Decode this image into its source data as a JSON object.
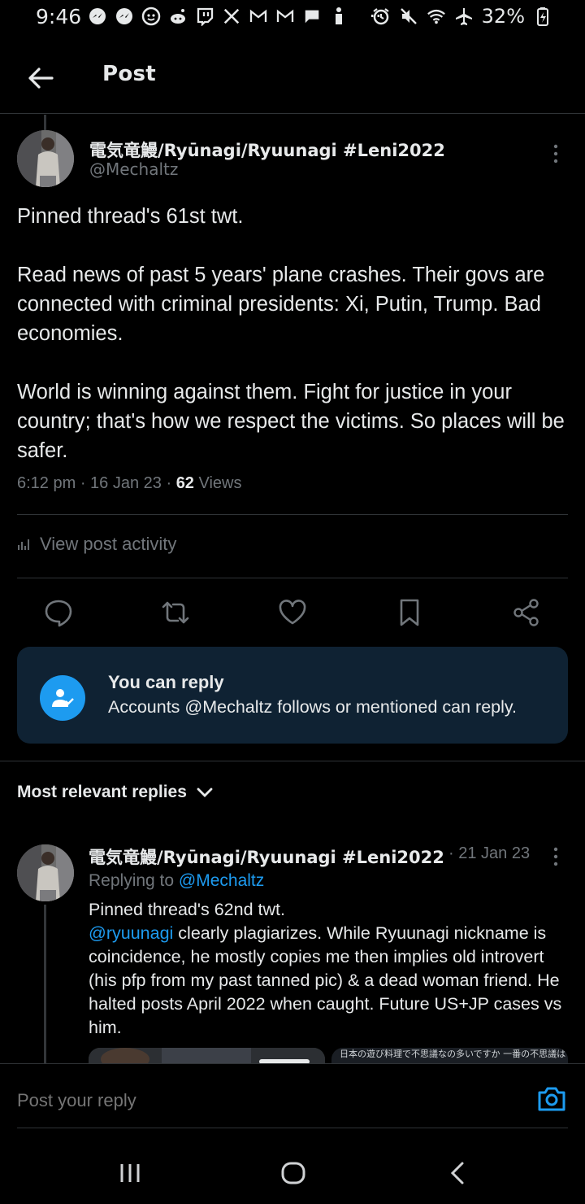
{
  "status_bar": {
    "time": "9:46",
    "battery": "32%",
    "dots": "··"
  },
  "header": {
    "title": "Post"
  },
  "post": {
    "author_name": "電気竜鰻/Ryūnagi/Ryuunagi #Leni2022",
    "handle": "@Mechaltz",
    "paragraphs": [
      "Pinned thread's 61st twt.",
      "Read news of past 5 years' plane crashes. Their govs are connected with criminal presidents: Xi, Putin, Trump. Bad economies.",
      "World is winning against them. Fight for justice in your country; that's how we respect the victims. So places will be safer."
    ],
    "time": "6:12 pm",
    "sep1": " · ",
    "date": "16 Jan 23",
    "sep2": " · ",
    "views_count": "62",
    "views_label": " Views",
    "view_activity": "View post activity"
  },
  "reply_notice": {
    "title": "You can reply",
    "text": "Accounts @Mechaltz follows or mentioned can reply."
  },
  "replies_sort": {
    "label": "Most relevant replies"
  },
  "reply": {
    "author_name": "電気竜鰻/Ryūnagi/Ryuunagi #Leni2022",
    "date": "· 21 Jan 23",
    "replying_to_label": "Replying to ",
    "replying_to_handle": "@Mechaltz",
    "line1": "Pinned thread's 62nd twt.",
    "mention": "@ryuunagi",
    "body": " clearly plagiarizes. While Ryuunagi nickname is coincidence, he mostly copies me then implies old introvert (his pfp from my past tanned pic) & a dead woman friend. He halted posts April 2022 when caught. Future US+JP cases vs him.",
    "media_2_text": "日本の遊び料理で不思議なの多いですか 一番の不思議は「米粉麺（こめこ）」と"
  },
  "composer": {
    "placeholder": "Post your reply"
  },
  "colors": {
    "accent": "#1d9bf0",
    "background": "#000000",
    "muted": "#71767b",
    "text": "#e7e9ea",
    "notice_bg": "#0f2233"
  }
}
